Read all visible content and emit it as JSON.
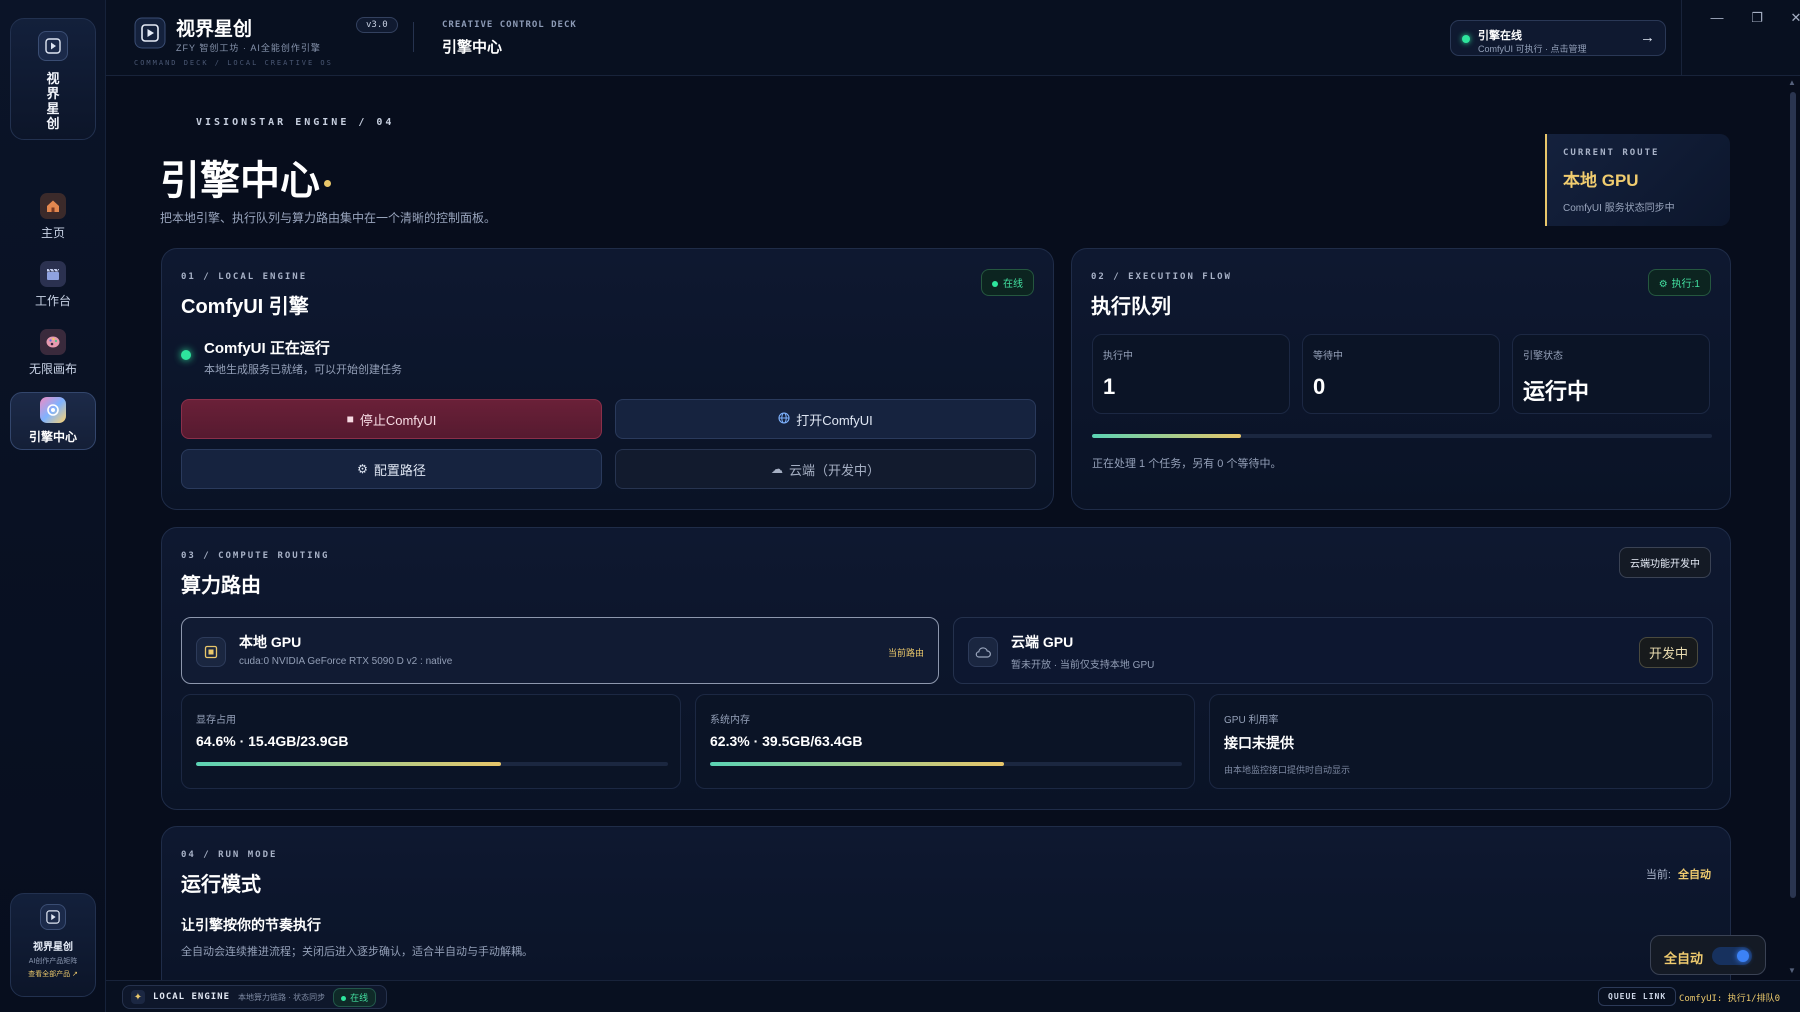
{
  "sidebar": {
    "brand_vertical": "视界星创",
    "items": [
      {
        "label": "主页",
        "icon": "home-icon"
      },
      {
        "label": "工作台",
        "icon": "clapper-icon"
      },
      {
        "label": "无限画布",
        "icon": "palette-icon"
      },
      {
        "label": "引擎中心",
        "icon": "engine-icon",
        "active": true
      }
    ],
    "footer": {
      "title": "视界星创",
      "subtitle": "AI创作产品矩阵",
      "link": "查看全部产品 ↗"
    }
  },
  "topbar": {
    "app_name": "视界星创",
    "app_sub": "ZFY 智创工坊 · AI全能创作引擎",
    "version": "v3.0",
    "crumb": "COMMAND DECK / LOCAL CREATIVE OS",
    "deck_label": "CREATIVE CONTROL DECK",
    "title": "引擎中心",
    "status_title": "引擎在线",
    "status_sub": "ComfyUI 可执行 · 点击管理",
    "status_arrow": "→",
    "win_min": "—",
    "win_restore": "❐",
    "win_close": "✕"
  },
  "page": {
    "kicker": "VISIONSTAR ENGINE / 04",
    "title": "引擎中心",
    "desc": "把本地引擎、执行队列与算力路由集中在一个清晰的控制面板。",
    "route": {
      "label": "CURRENT ROUTE",
      "value": "本地 GPU",
      "sub": "ComfyUI 服务状态同步中"
    }
  },
  "engine": {
    "kicker": "01 / LOCAL ENGINE",
    "title": "ComfyUI 引擎",
    "badge": "在线",
    "status_title": "ComfyUI 正在运行",
    "status_sub": "本地生成服务已就绪，可以开始创建任务",
    "btn_stop": "停止ComfyUI",
    "btn_open": "打开ComfyUI",
    "btn_config": "配置路径",
    "btn_cloud": "云端（开发中）"
  },
  "queue": {
    "kicker": "02 / EXECUTION FLOW",
    "title": "执行队列",
    "badge": "执行:1",
    "stats": [
      {
        "label": "执行中",
        "value": "1"
      },
      {
        "label": "等待中",
        "value": "0"
      },
      {
        "label": "引擎状态",
        "value": "运行中"
      }
    ],
    "progress": 0.24,
    "note": "正在处理 1 个任务，另有 0 个等待中。"
  },
  "routing": {
    "kicker": "03 / COMPUTE ROUTING",
    "title": "算力路由",
    "badge": "云端功能开发中",
    "local": {
      "title": "本地 GPU",
      "sub": "cuda:0 NVIDIA GeForce RTX 5090 D v2 : native",
      "tag": "当前路由"
    },
    "cloud": {
      "title": "云端 GPU",
      "sub": "暂未开放 · 当前仅支持本地 GPU",
      "tag": "开发中"
    },
    "metrics": [
      {
        "label": "显存占用",
        "value": "64.6% · 15.4GB/23.9GB",
        "progress": 0.646
      },
      {
        "label": "系统内存",
        "value": "62.3% · 39.5GB/63.4GB",
        "progress": 0.623
      },
      {
        "label": "GPU 利用率",
        "value": "接口未提供",
        "sub": "由本地监控接口提供时自动显示"
      }
    ]
  },
  "runmode": {
    "kicker": "04 / RUN MODE",
    "title": "运行模式",
    "current_label": "当前:",
    "current_value": "全自动",
    "heading": "让引擎按你的节奏执行",
    "desc": "全自动会连续推进流程；关闭后进入逐步确认，适合半自动与手动解耦。",
    "toggle_label": "全自动"
  },
  "footer": {
    "engine_key": "LOCAL ENGINE",
    "engine_sub": "本地算力链路 · 状态同步",
    "engine_status": "在线",
    "queue_link": "QUEUE LINK",
    "queue_text": "ComfyUI: 执行1/排队0"
  },
  "colors": {
    "accent_gold": "#e8c66a",
    "online_green": "#2ee59d",
    "danger": "#6a2038",
    "toggle_blue": "#3c82f6"
  }
}
